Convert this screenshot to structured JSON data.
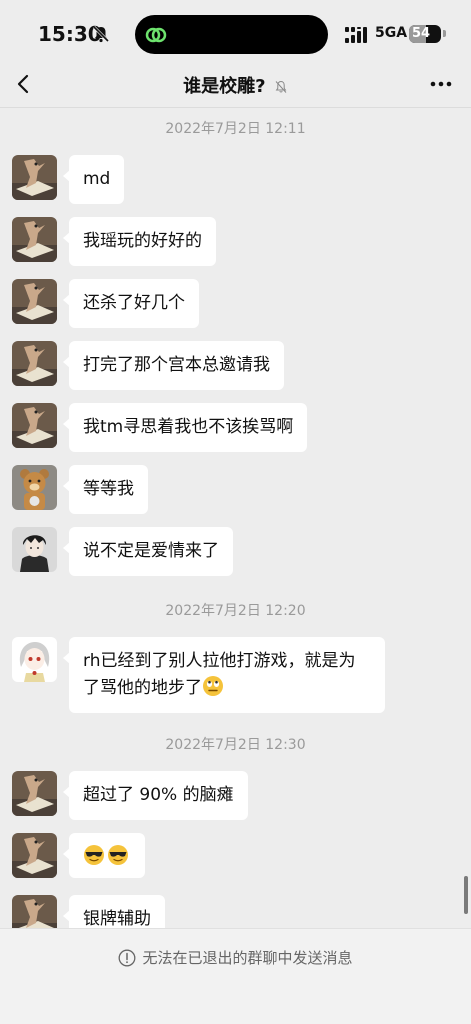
{
  "status_bar": {
    "time": "15:30",
    "network": "5GA",
    "battery": "54",
    "battery_level": 0.54
  },
  "nav": {
    "title": "谁是校雕?"
  },
  "messages": [
    {
      "type": "timestamp",
      "text": "2022年7月2日 12:11"
    },
    {
      "type": "message",
      "avatar": "bird-avatar",
      "text": "md"
    },
    {
      "type": "message",
      "avatar": "bird-avatar",
      "text": "我瑶玩的好好的"
    },
    {
      "type": "message",
      "avatar": "bird-avatar",
      "text": "还杀了好几个"
    },
    {
      "type": "message",
      "avatar": "bird-avatar",
      "text": "打完了那个宫本总邀请我"
    },
    {
      "type": "message",
      "avatar": "bird-avatar",
      "text": "我tm寻思着我也不该挨骂啊"
    },
    {
      "type": "message",
      "avatar": "bear-avatar",
      "text": "等等我"
    },
    {
      "type": "message",
      "avatar": "anime-avatar",
      "text": "说不定是爱情来了"
    },
    {
      "type": "timestamp",
      "text": "2022年7月2日 12:20"
    },
    {
      "type": "message",
      "avatar": "girl-avatar",
      "text_line1": "rh已经到了别人拉他打游戏，就是为",
      "text_line2": "了骂他的地步了"
    },
    {
      "type": "timestamp",
      "text": "2022年7月2日 12:30"
    },
    {
      "type": "message",
      "avatar": "bird-avatar",
      "text": "超过了 90% 的脑瘫"
    },
    {
      "type": "message",
      "avatar": "bird-avatar",
      "emoji": "sunglasses-emoji x2"
    },
    {
      "type": "message",
      "avatar": "bird-avatar",
      "text": "银牌辅助"
    }
  ],
  "footer": {
    "notice": "无法在已退出的群聊中发送消息"
  },
  "icons": {
    "back": "chevron-left-icon",
    "mute": "bell-off-icon",
    "more": "more-dots-icon",
    "info": "info-circle-icon"
  },
  "colors": {
    "background": "#ededed",
    "bubble": "#ffffff",
    "timestamp": "#9a9a9a"
  }
}
